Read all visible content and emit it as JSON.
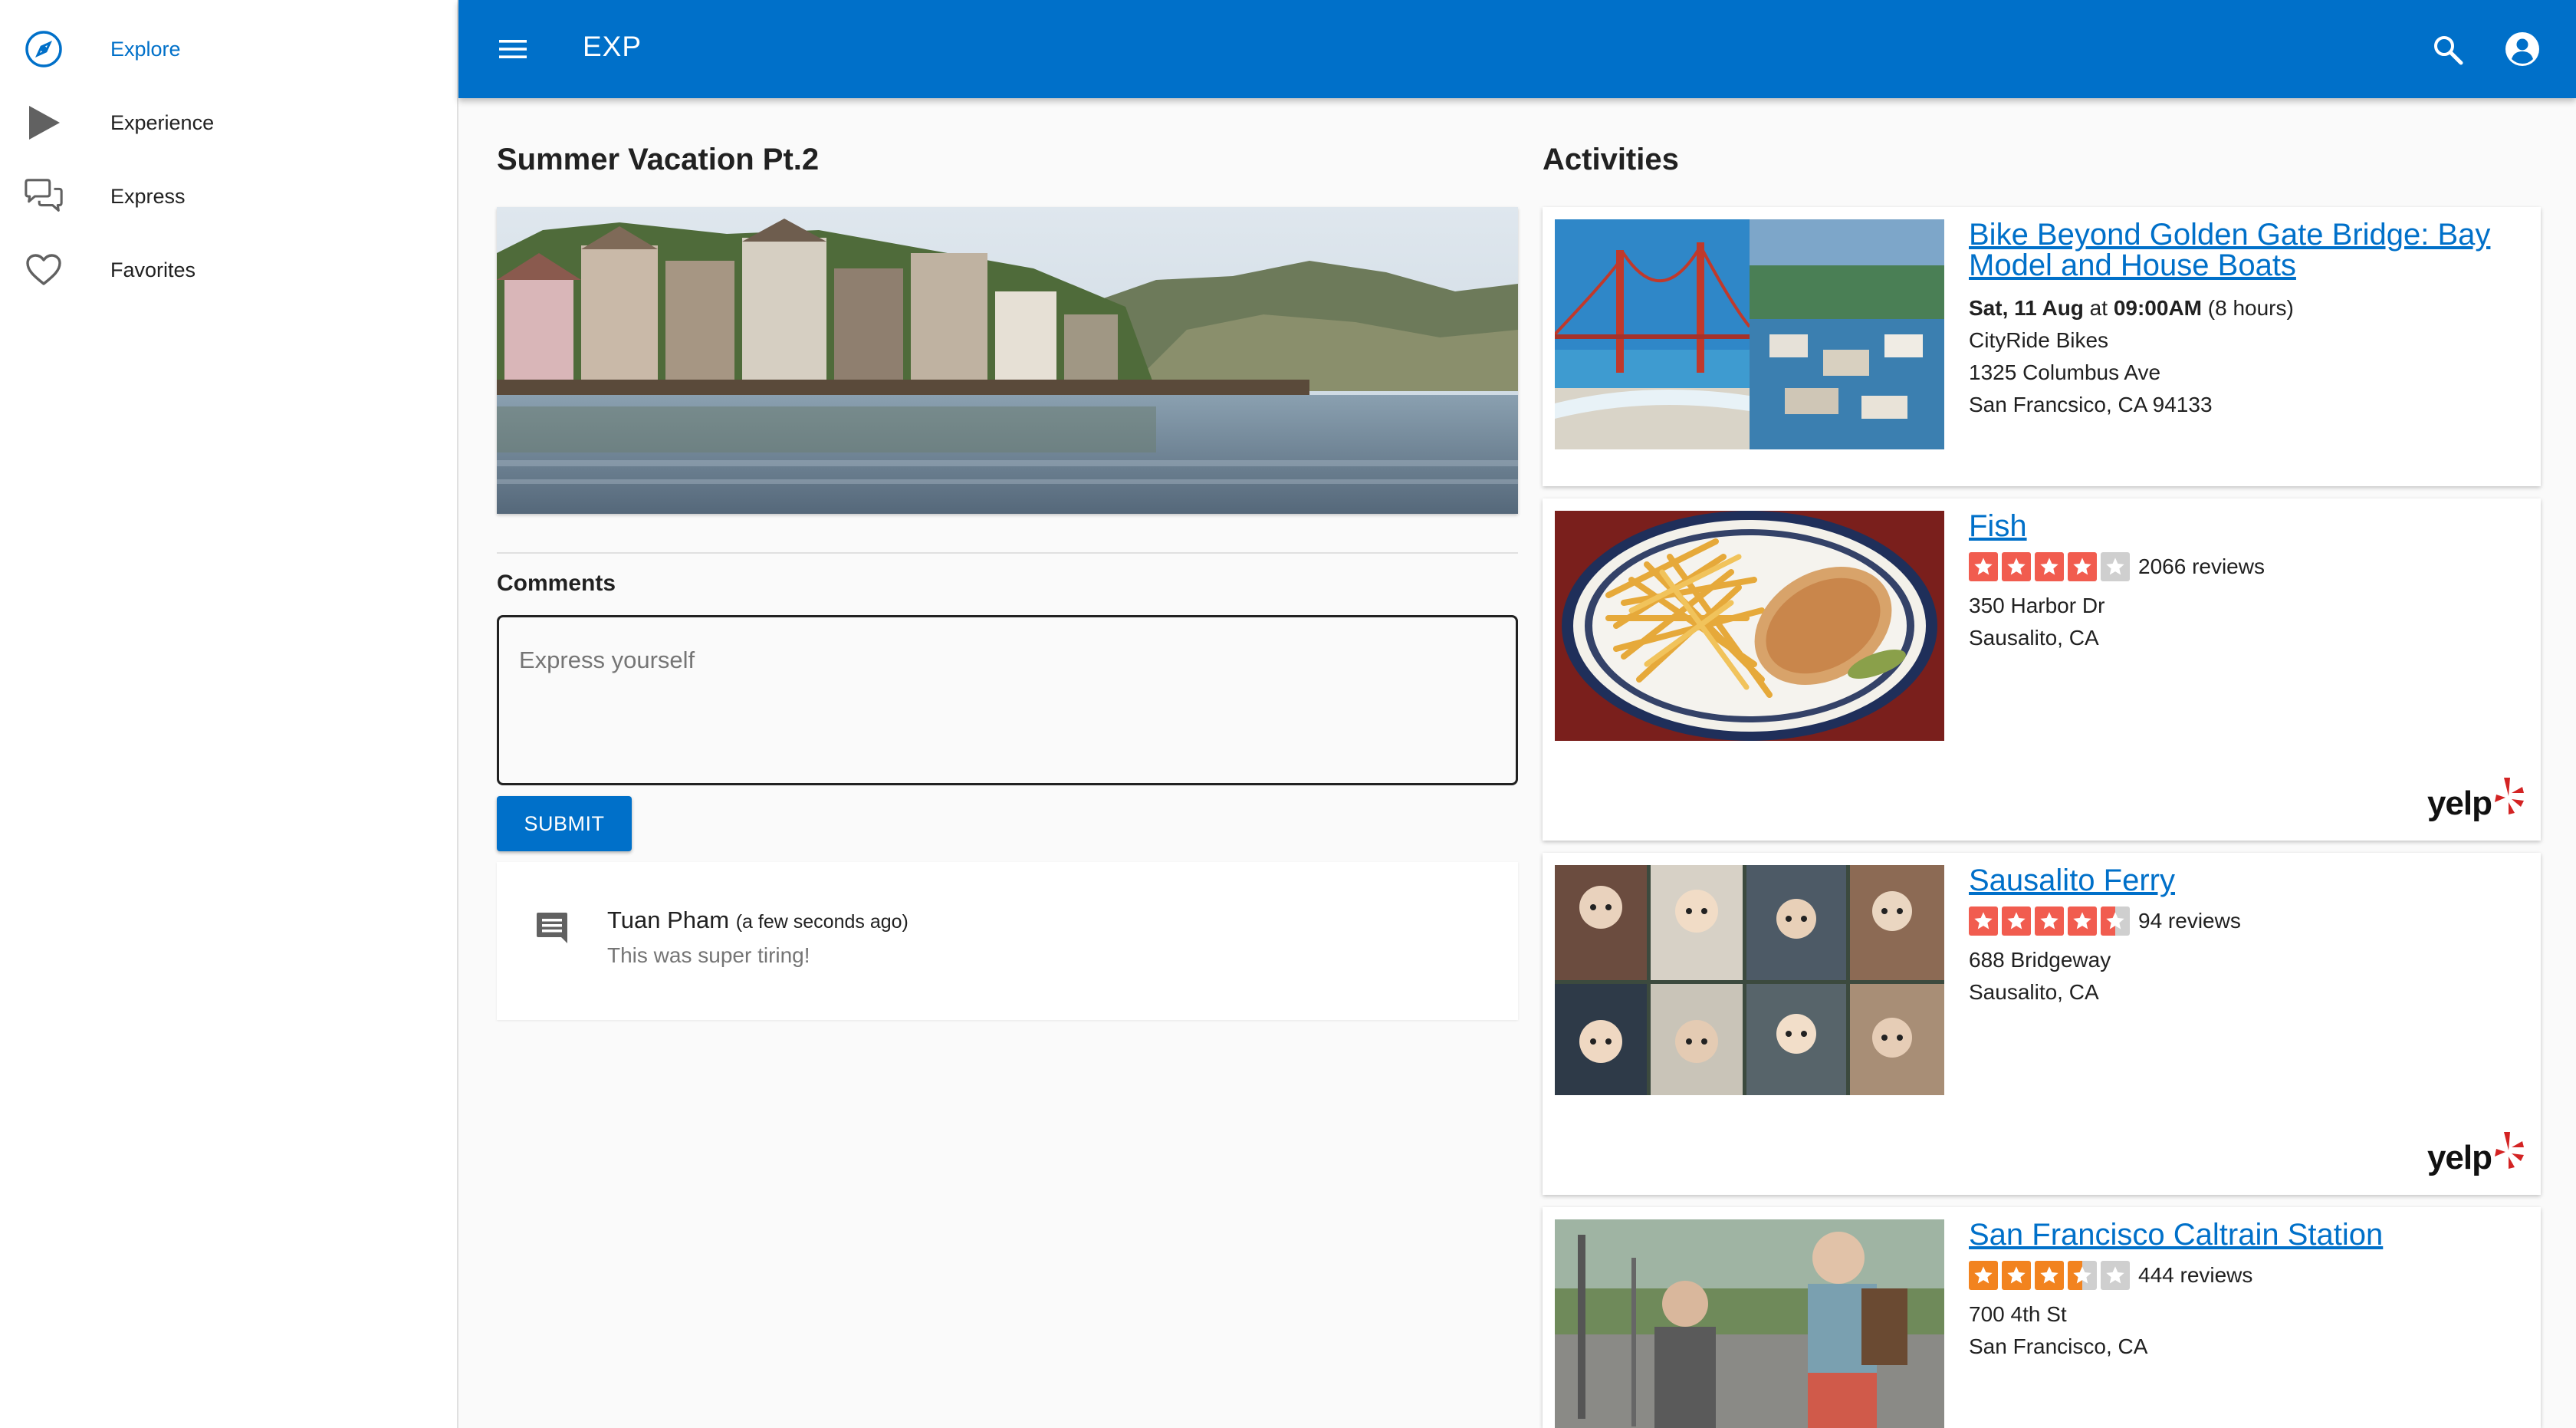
{
  "sidebar": {
    "items": [
      {
        "label": "Explore",
        "icon": "compass-icon",
        "active": true
      },
      {
        "label": "Experience",
        "icon": "play-icon",
        "active": false
      },
      {
        "label": "Express",
        "icon": "chat-bubbles-icon",
        "active": false
      },
      {
        "label": "Favorites",
        "icon": "heart-icon",
        "active": false
      }
    ]
  },
  "topbar": {
    "title": "EXP",
    "menu_icon": "hamburger-menu-icon",
    "search_icon": "search-icon",
    "account_icon": "account-circle-icon",
    "color": "#0070c9"
  },
  "post": {
    "title": "Summer Vacation Pt.2",
    "comments_label": "Comments",
    "comment_placeholder": "Express yourself",
    "submit_label": "SUBMIT",
    "comments": [
      {
        "author": "Tuan Pham",
        "time": "(a few seconds ago)",
        "text": "This was super tiring!"
      }
    ]
  },
  "activities": {
    "title": "Activities",
    "items": [
      {
        "title": "Bike Beyond Golden Gate Bridge: Bay Model and House Boats",
        "date_bold": "Sat, 11 Aug",
        "date_mid": " at ",
        "time_bold": "09:00AM",
        "duration": " (8 hours)",
        "vendor": "CityRide Bikes",
        "address1": "1325 Columbus Ave",
        "address2": "San Francsico, CA 94133"
      },
      {
        "title": "Fish",
        "rating": 4,
        "reviews": "2066 reviews",
        "address1": "350 Harbor Dr",
        "address2": "Sausalito, CA",
        "badge": "yelp"
      },
      {
        "title": "Sausalito Ferry",
        "rating": 4.5,
        "reviews": "94 reviews",
        "address1": "688 Bridgeway",
        "address2": "Sausalito, CA",
        "badge": "yelp"
      },
      {
        "title": "San Francisco Caltrain Station",
        "rating": 3.5,
        "reviews": "444 reviews",
        "address1": "700 4th St",
        "address2": "San Francisco, CA"
      }
    ]
  },
  "colors": {
    "accent": "#0070c9",
    "star_red": "#f15c4f",
    "star_orange": "#f2831f",
    "star_empty": "#cfcfcf"
  }
}
